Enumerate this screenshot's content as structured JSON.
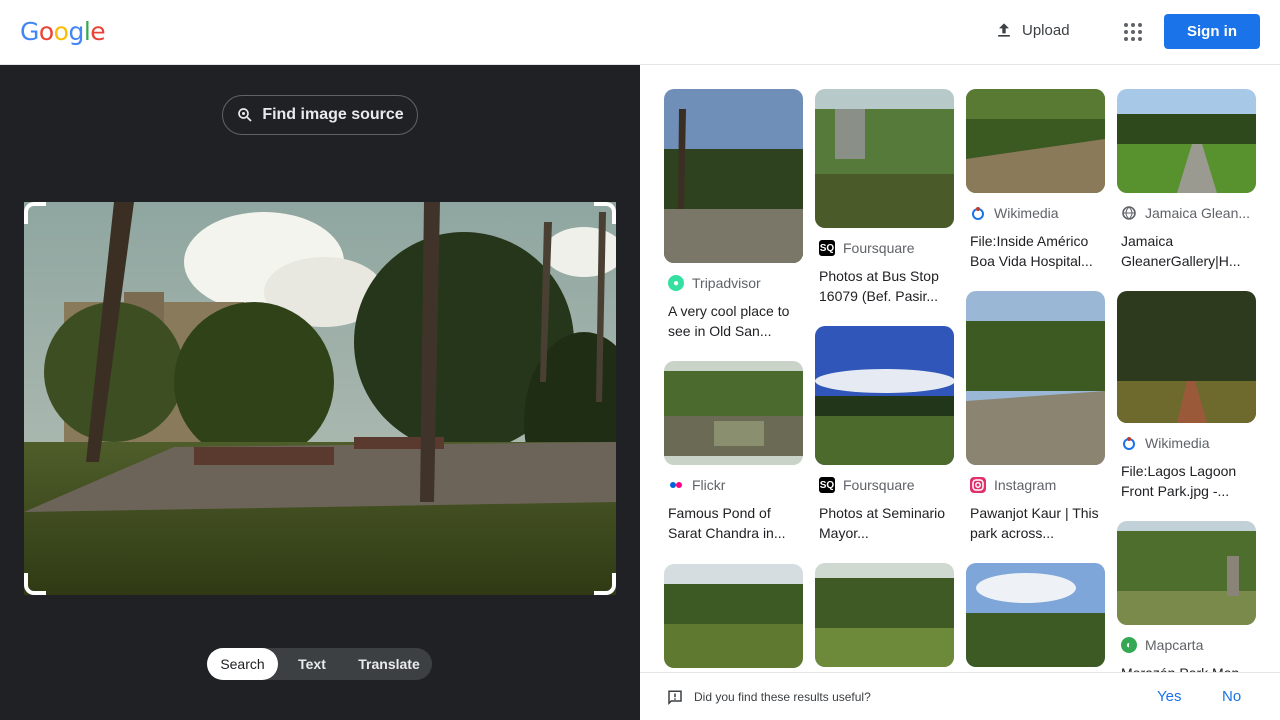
{
  "header": {
    "logo": "Google",
    "upload_label": "Upload",
    "signin_label": "Sign in"
  },
  "left": {
    "find_source_label": "Find image source",
    "modes": [
      "Search",
      "Text",
      "Translate"
    ],
    "active_mode": "Search"
  },
  "results": {
    "items": [
      {
        "source": "Tripadvisor",
        "title": "A very cool place to see in Old San...",
        "favicon": "tripadvisor-icon",
        "favicon_color": "#34e0a1"
      },
      {
        "source": "Foursquare",
        "title": "Photos at Bus Stop 16079 (Bef. Pasir...",
        "favicon": "foursquare-icon",
        "favicon_color": "#000000"
      },
      {
        "source": "Wikimedia",
        "title": "File:Inside Américo Boa Vida Hospital...",
        "favicon": "wikimedia-icon",
        "favicon_color": "#1a73e8"
      },
      {
        "source": "Jamaica Glean...",
        "title": "Jamaica GleanerGallery|H...",
        "favicon": "globe-icon",
        "favicon_color": "#5f6368"
      },
      {
        "source": "Flickr",
        "title": "Famous Pond of Sarat Chandra in...",
        "favicon": "flickr-icon",
        "favicon_color": "#0063dc"
      },
      {
        "source": "Foursquare",
        "title": "Photos at Seminario Mayor...",
        "favicon": "foursquare-icon",
        "favicon_color": "#000000"
      },
      {
        "source": "Instagram",
        "title": "Pawanjot Kaur | This park across...",
        "favicon": "instagram-icon",
        "favicon_color": "#e1306c"
      },
      {
        "source": "Wikimedia",
        "title": "File:Lagos Lagoon Front Park.jpg -...",
        "favicon": "wikimedia-icon",
        "favicon_color": "#1a73e8"
      },
      {
        "source": "Mapcarta",
        "title": "Morazán Park Map...",
        "favicon": "mapcarta-icon",
        "favicon_color": "#34a853"
      }
    ]
  },
  "feedback": {
    "question": "Did you find these results useful?",
    "yes": "Yes",
    "no": "No"
  },
  "colors": {
    "accent": "#1a73e8",
    "dark_panel": "#202124"
  }
}
